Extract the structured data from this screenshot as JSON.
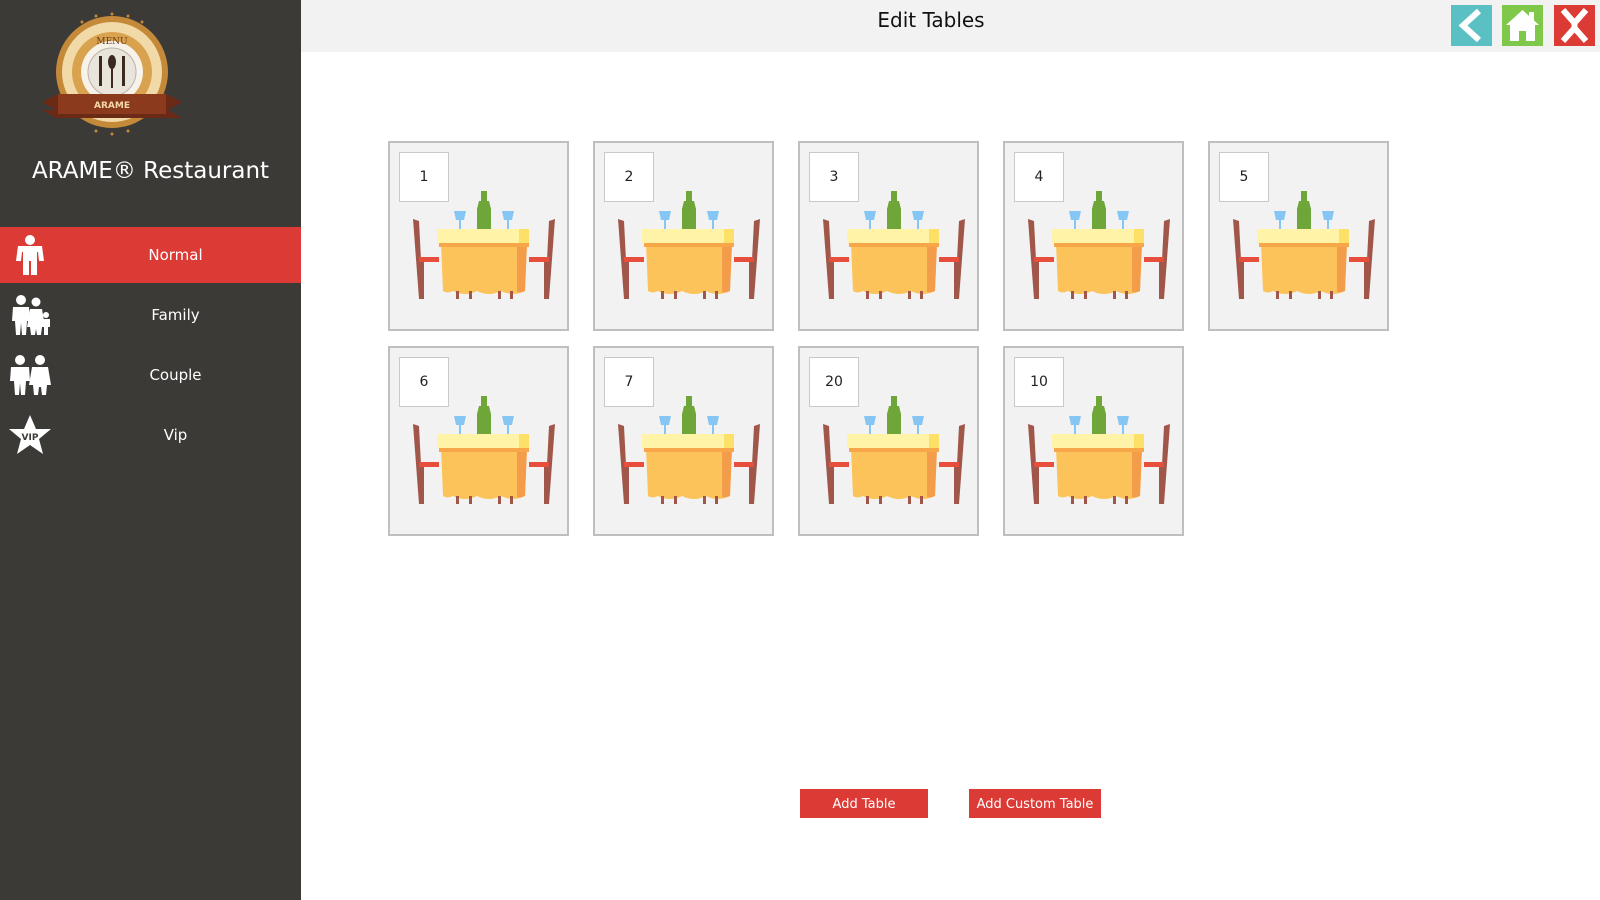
{
  "app": {
    "brand": "ARAME® Restaurant",
    "logo_top_text": "MENU",
    "logo_ribbon_text": "ARAME"
  },
  "sidebar": {
    "items": [
      {
        "label": "Normal",
        "icon": "person-icon",
        "active": true
      },
      {
        "label": "Family",
        "icon": "family-icon",
        "active": false
      },
      {
        "label": "Couple",
        "icon": "couple-icon",
        "active": false
      },
      {
        "label": "Vip",
        "icon": "vip-star-icon",
        "active": false
      }
    ]
  },
  "header": {
    "title": "Edit Tables",
    "back_icon": "back-arrow-icon",
    "home_icon": "home-icon",
    "close_icon": "close-x-icon"
  },
  "tables": [
    {
      "number": "1"
    },
    {
      "number": "2"
    },
    {
      "number": "3"
    },
    {
      "number": "4"
    },
    {
      "number": "5"
    },
    {
      "number": "6"
    },
    {
      "number": "7"
    },
    {
      "number": "20"
    },
    {
      "number": "10"
    }
  ],
  "actions": {
    "add_table": "Add Table",
    "add_custom_table": "Add Custom Table"
  },
  "colors": {
    "sidebar_bg": "#3b3a37",
    "accent_red": "#dc3a34",
    "back_teal": "#5ac0c4",
    "home_green": "#7fc84a"
  }
}
